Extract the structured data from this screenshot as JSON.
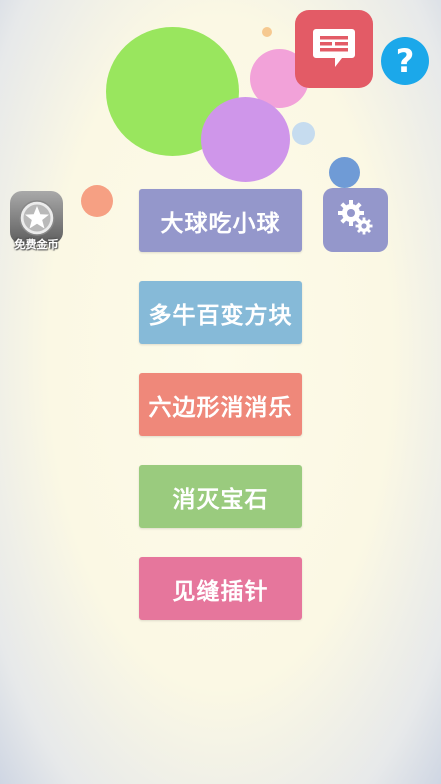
{
  "menu": {
    "items": [
      {
        "label": "大球吃小球",
        "color": "#9497cb"
      },
      {
        "label": "多牛百变方块",
        "color": "#86bad8"
      },
      {
        "label": "六边形消消乐",
        "color": "#ef887a"
      },
      {
        "label": "消灭宝石",
        "color": "#9acb7e"
      },
      {
        "label": "见缝插针",
        "color": "#e6769c"
      }
    ]
  },
  "settings": {
    "icon": "gear-icon",
    "color": "#9497cb"
  },
  "messages": {
    "icon": "message-icon",
    "color": "#e35b66"
  },
  "help": {
    "icon": "question-icon",
    "color": "#1ba8ea",
    "glyph": "?"
  },
  "free_coins": {
    "icon": "star-icon",
    "label": "免费金币"
  },
  "colors": {
    "bubble_green": "#99e65e",
    "bubble_pink": "#f2a2d9",
    "bubble_purple": "#cf96ea",
    "bubble_orange": "#f6a083",
    "bubble_blue": "#6f9bd6",
    "bubble_lightblue": "#c6dcef",
    "bubble_peach": "#f6c990"
  }
}
